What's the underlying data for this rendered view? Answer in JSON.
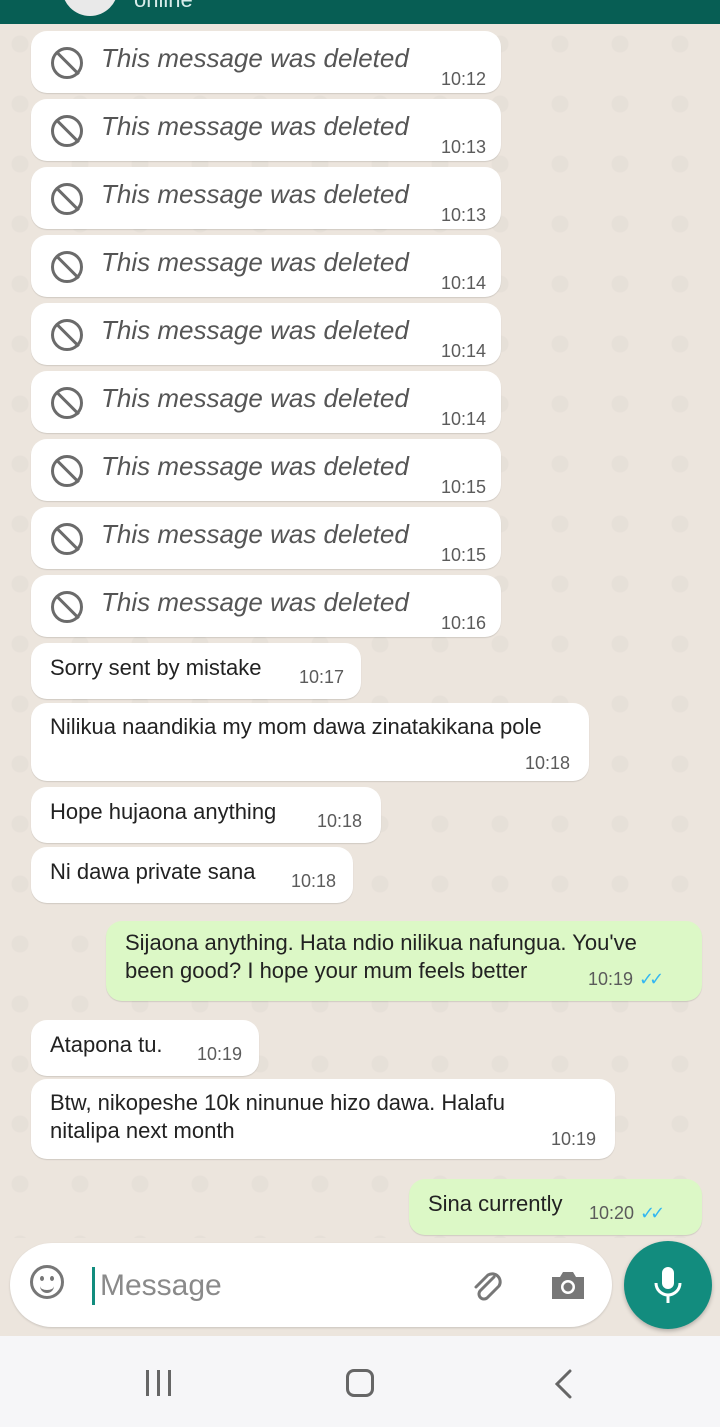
{
  "header": {
    "status": "online"
  },
  "messages": [
    {
      "dir": "in",
      "deleted": true,
      "text": "This message was deleted",
      "time": "10:12"
    },
    {
      "dir": "in",
      "deleted": true,
      "text": "This message was deleted",
      "time": "10:13"
    },
    {
      "dir": "in",
      "deleted": true,
      "text": "This message was deleted",
      "time": "10:13"
    },
    {
      "dir": "in",
      "deleted": true,
      "text": "This message was deleted",
      "time": "10:14"
    },
    {
      "dir": "in",
      "deleted": true,
      "text": "This message was deleted",
      "time": "10:14"
    },
    {
      "dir": "in",
      "deleted": true,
      "text": "This message was deleted",
      "time": "10:14"
    },
    {
      "dir": "in",
      "deleted": true,
      "text": "This message was deleted",
      "time": "10:15"
    },
    {
      "dir": "in",
      "deleted": true,
      "text": "This message was deleted",
      "time": "10:15"
    },
    {
      "dir": "in",
      "deleted": true,
      "text": "This message was deleted",
      "time": "10:16"
    },
    {
      "dir": "in",
      "text": "Sorry sent by mistake",
      "time": "10:17"
    },
    {
      "dir": "in",
      "text": "Nilikua naandikia my mom dawa zinatakikana pole",
      "time": "10:18"
    },
    {
      "dir": "in",
      "text": "Hope hujaona anything",
      "time": "10:18"
    },
    {
      "dir": "in",
      "text": "Ni dawa private sana",
      "time": "10:18"
    },
    {
      "dir": "out",
      "text": "Sijaona anything. Hata ndio nilikua nafungua. You've\nbeen good? I hope your mum feels better",
      "time": "10:19",
      "read": true
    },
    {
      "dir": "in",
      "text": "Atapona tu.",
      "time": "10:19"
    },
    {
      "dir": "in",
      "text": "Btw, nikopeshe 10k ninunue hizo dawa. Halafu\nnitalipa next month",
      "time": "10:19"
    },
    {
      "dir": "out",
      "text": "Sina currently",
      "time": "10:20",
      "read": true
    }
  ],
  "input": {
    "placeholder": "Message"
  },
  "icons": {
    "deleted": "block-icon",
    "emoji": "emoji-icon",
    "attach": "paperclip-icon",
    "camera": "camera-icon",
    "mic": "mic-icon",
    "read_receipt": "double-check-icon"
  },
  "colors": {
    "chat_background": "#ece5dd",
    "incoming_bubble": "#ffffff",
    "outgoing_bubble": "#dcf8c6",
    "accent": "#128c7e",
    "header": "#075e54",
    "read_ticks": "#34b7f1"
  }
}
